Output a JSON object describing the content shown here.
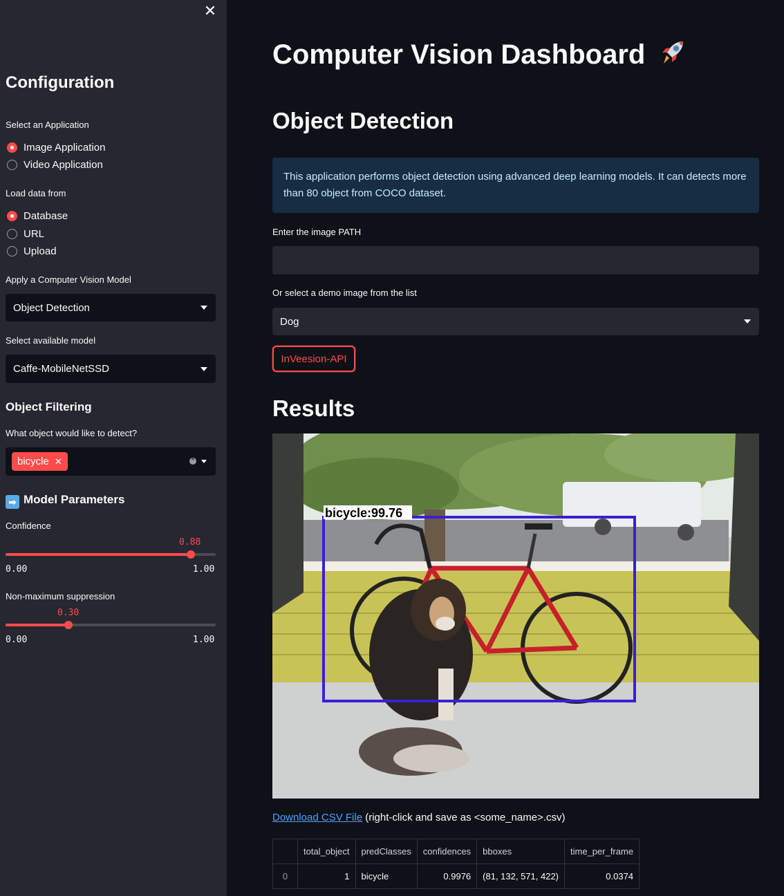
{
  "sidebar": {
    "title": "Configuration",
    "application": {
      "label": "Select an Application",
      "options": [
        "Image Application",
        "Video Application"
      ],
      "selected": "Image Application"
    },
    "load_from": {
      "label": "Load data from",
      "options": [
        "Database",
        "URL",
        "Upload"
      ],
      "selected": "Database"
    },
    "cv_model": {
      "label": "Apply a Computer Vision Model",
      "value": "Object Detection"
    },
    "available_model": {
      "label": "Select available model",
      "value": "Caffe-MobileNetSSD"
    },
    "filtering": {
      "heading": "Object Filtering",
      "label": "What object would like to detect?",
      "tags": [
        "bicycle"
      ]
    },
    "params": {
      "heading": "Model Parameters",
      "confidence": {
        "label": "Confidence",
        "value": "0.88",
        "min": "0.00",
        "max": "1.00",
        "fraction": 0.88
      },
      "nms": {
        "label": "Non-maximum suppression",
        "value": "0.30",
        "min": "0.00",
        "max": "1.00",
        "fraction": 0.3
      }
    }
  },
  "main": {
    "title": "Computer Vision Dashboard",
    "section_title": "Object Detection",
    "info": "This application performs object detection using advanced deep learning models. It can detects more than 80 object from COCO dataset.",
    "path_label": "Enter the image PATH",
    "path_value": "",
    "demo_label": "Or select a demo image from the list",
    "demo_value": "Dog",
    "api_button": "InVeesion-API",
    "results_title": "Results",
    "detection_label": "bicycle:99.76",
    "csv_link": "Download CSV File",
    "csv_hint": " (right-click and save as <some_name>.csv)",
    "table": {
      "headers": [
        "",
        "total_object",
        "predClasses",
        "confidences",
        "bboxes",
        "time_per_frame"
      ],
      "rows": [
        [
          "0",
          "1",
          "bicycle",
          "0.9976",
          "(81, 132, 571, 422)",
          "0.0374"
        ]
      ]
    }
  },
  "colors": {
    "accent": "#ff4b4b",
    "bbox": "#3a1fd6",
    "link": "#4aa3ff"
  }
}
